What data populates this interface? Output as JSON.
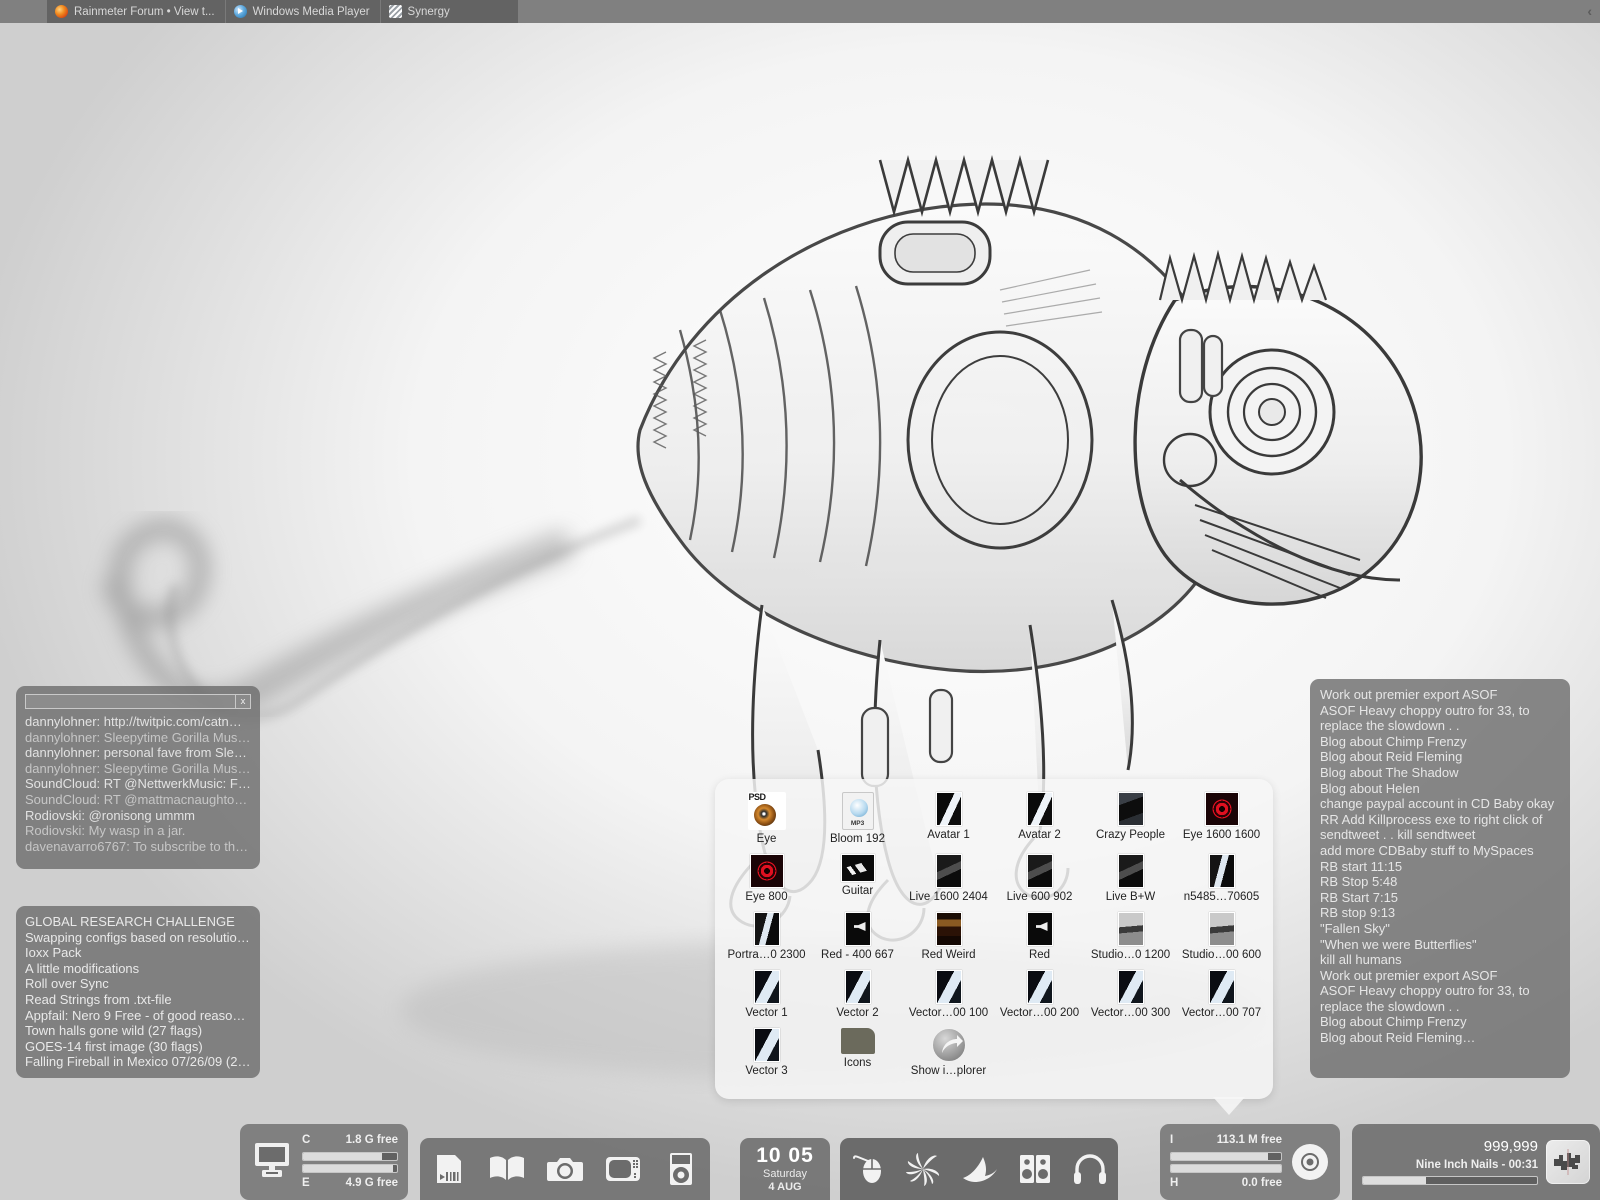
{
  "taskbar": {
    "buttons": [
      {
        "label": "Rainmeter Forum • View t...",
        "icon": "firefox-icon"
      },
      {
        "label": "Windows Media Player",
        "icon": "windows-media-player-icon"
      },
      {
        "label": "Synergy",
        "icon": "synergy-icon"
      }
    ],
    "tray_chevron": "‹"
  },
  "twitter_widget": {
    "search_value": "",
    "search_placeholder": "",
    "close_label": "x",
    "lines": [
      "dannylohner: http://twitpic.com/catn…",
      "dannylohner: Sleepytime Gorilla Muse…",
      "dannylohner: personal fave from Slee…",
      "dannylohner: Sleepytime Gorilla Muse…",
      "SoundCloud: RT @NettwerkMusic: Feli…",
      "SoundCloud: RT @mattmacnaughton:…",
      "Rodiovski: @ronisong ummm",
      "Rodiovski: My wasp in a jar.",
      "davenavarro6767: To subscribe to the…"
    ]
  },
  "news_widget": {
    "lines": [
      "GLOBAL RESEARCH CHALLENGE",
      "Swapping configs based on resolution…",
      "Ioxx Pack",
      "A little modifications",
      "Roll over Sync",
      "Read Strings from .txt-file",
      "Appfail: Nero 9 Free - of good reasons…",
      "Town halls gone wild (27 flags)",
      "GOES-14 first image (30 flags)",
      "Falling Fireball in Mexico 07/26/09 (24…"
    ]
  },
  "todo_widget": {
    "lines": [
      "Work out premier export ASOF",
      "ASOF Heavy choppy outro for 33, to",
      "replace the slowdown . .",
      "Blog about Chimp Frenzy",
      "Blog about Reid Fleming",
      "Blog about The Shadow",
      "Blog about Helen",
      "change paypal account in CD Baby okay",
      "RR Add Killprocess exe to right click of",
      "sendtweet . . kill sendtweet",
      "add more CDBaby stuff to MySpaces",
      "RB start 11:15",
      "RB Stop 5:48",
      "RB Start 7:15",
      "RB stop 9:13",
      "\"Fallen Sky\"",
      "\"When we were Butterflies\"",
      "kill all humans",
      "Work out premier export ASOF",
      "ASOF Heavy choppy outro for 33, to",
      "replace the slowdown . .",
      "Blog about Chimp Frenzy",
      "Blog about Reid Fleming…"
    ]
  },
  "icon_popup": {
    "items": [
      {
        "label": "Eye",
        "thumb": "psd-file-icon"
      },
      {
        "label": "Bloom 192",
        "thumb": "mp3-file-icon"
      },
      {
        "label": "Avatar 1",
        "thumb": "portrait-bw-thumb"
      },
      {
        "label": "Avatar 2",
        "thumb": "portrait-bw-thumb"
      },
      {
        "label": "Crazy People",
        "thumb": "crazy-people-thumb"
      },
      {
        "label": "Eye 1600 1600",
        "thumb": "eye-target-thumb"
      },
      {
        "label": "Eye 800",
        "thumb": "eye-target-thumb"
      },
      {
        "label": "Guitar",
        "thumb": "guitar-thumb"
      },
      {
        "label": "Live 1600 2404",
        "thumb": "live-thumb"
      },
      {
        "label": "Live 600 902",
        "thumb": "live-thumb"
      },
      {
        "label": "Live B+W",
        "thumb": "live-thumb"
      },
      {
        "label": "n5485…70605",
        "thumb": "portrait-bw2-thumb"
      },
      {
        "label": "Portra…0 2300",
        "thumb": "portrait-bw2-thumb"
      },
      {
        "label": "Red - 400 667",
        "thumb": "red-400-thumb"
      },
      {
        "label": "Red Weird",
        "thumb": "red-weird-thumb"
      },
      {
        "label": "Red",
        "thumb": "red-400-thumb"
      },
      {
        "label": "Studio…0 1200",
        "thumb": "studio-thumb"
      },
      {
        "label": "Studio…00 600",
        "thumb": "studio-thumb"
      },
      {
        "label": "Vector 1",
        "thumb": "vector-thumb"
      },
      {
        "label": "Vector 2",
        "thumb": "vector-thumb"
      },
      {
        "label": "Vector…00 100",
        "thumb": "vector-thumb"
      },
      {
        "label": "Vector…00 200",
        "thumb": "vector-thumb"
      },
      {
        "label": "Vector…00 300",
        "thumb": "vector-thumb"
      },
      {
        "label": "Vector…00 707",
        "thumb": "vector-thumb"
      },
      {
        "label": "Vector 3",
        "thumb": "vector-thumb"
      },
      {
        "label": "Icons",
        "thumb": "folder-icon"
      },
      {
        "label": "Show i…plorer",
        "thumb": "shortcut-arrow-icon"
      }
    ]
  },
  "drives_left": {
    "icon": "monitor-printer-icon",
    "rows": [
      {
        "letter": "C",
        "free": "1.8 G free",
        "fill_percent": 84
      },
      {
        "letter": "E",
        "free": "4.9 G free",
        "fill_percent": 96
      }
    ]
  },
  "dock_apps": {
    "icons": [
      "barcode-document-icon",
      "open-book-icon",
      "camera-icon",
      "television-icon",
      "ipod-icon"
    ]
  },
  "clock": {
    "time": "10 05",
    "day": "Saturday",
    "date": "4 AUG"
  },
  "dock_tools": {
    "icons": [
      "mouse-icon",
      "spiral-swirl-icon",
      "boomerang-icon",
      "speakers-icon",
      "headphones-icon"
    ]
  },
  "drives_right": {
    "rows": [
      {
        "letter": "I",
        "free": "113.1 M free",
        "fill_percent": 88
      },
      {
        "letter": "H",
        "free": "0.0 free",
        "fill_percent": 100
      }
    ],
    "icon": "optical-disc-icon"
  },
  "player": {
    "count": "999,999",
    "track": "Nine Inch Nails  -  00:31",
    "progress_percent": 36,
    "album_art_icon": "album-art-icon"
  },
  "colors": {
    "panel": "#6c6c6c",
    "taskbar": "#808080",
    "taskbar_strip": "#636363",
    "accent_red": "#e01020",
    "popup": "#f6f6f6"
  }
}
